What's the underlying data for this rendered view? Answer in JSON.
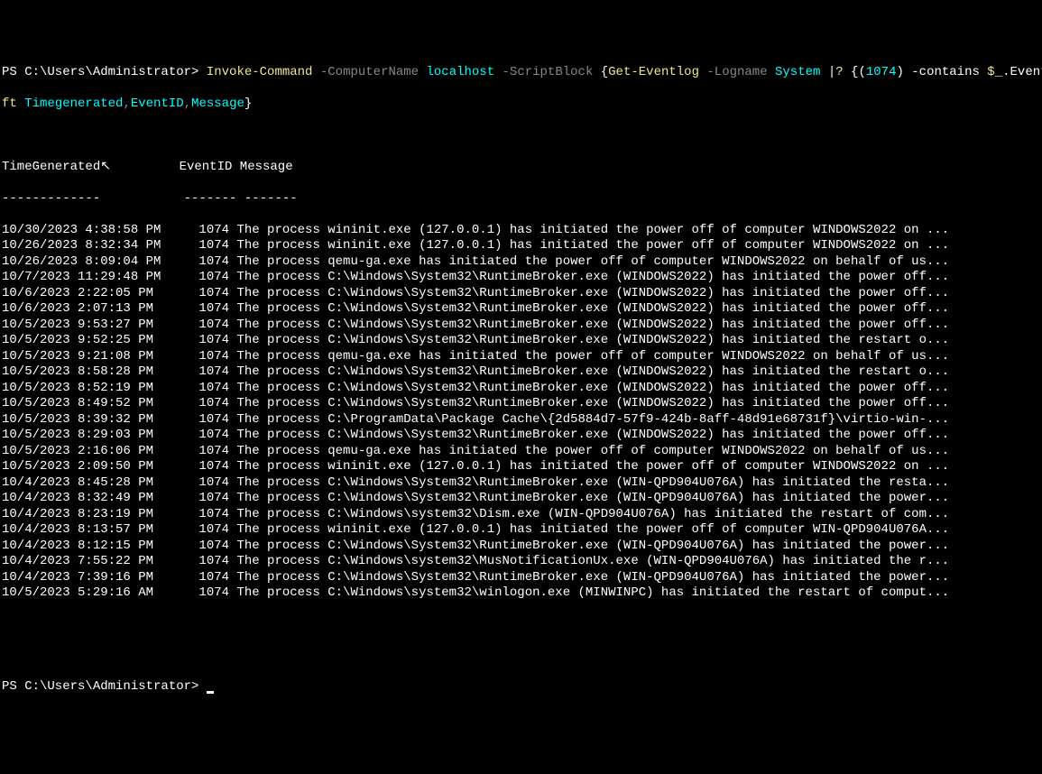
{
  "command": {
    "prompt_prefix": "PS C:\\Users\\Administrator> ",
    "cmd_yellow1": "Invoke-Command",
    "cmd_gray1": " -ComputerName ",
    "cmd_cyan1": "localhost",
    "cmd_gray2": " -ScriptBlock ",
    "cmd_white1": "{",
    "cmd_yellow2": "Get-Eventlog",
    "cmd_gray3": " -Logname ",
    "cmd_cyan2": "System",
    "cmd_white2": " |",
    "cmd_yellow3": "? ",
    "cmd_white3": "{(",
    "cmd_cyan3": "1074",
    "cmd_white4": ") -contains ",
    "cmd_yellow4": "$_",
    "cmd_white5": ".EventID} |",
    "line2_yellow": "ft",
    "line2_cyan": " Timegenerated",
    "line2_gray1": ",",
    "line2_cyan2": "EventID",
    "line2_gray2": ",",
    "line2_cyan3": "Message",
    "line2_white": "}"
  },
  "headers": {
    "col1": "TimeGenerated",
    "col2": "EventID",
    "col3": "Message",
    "sep1": "-------------",
    "sep2": "-------",
    "sep3": "-------"
  },
  "rows": [
    {
      "time": "10/30/2023 4:38:58 PM",
      "id": "1074",
      "msg": "The process wininit.exe (127.0.0.1) has initiated the power off of computer WINDOWS2022 on ..."
    },
    {
      "time": "10/26/2023 8:32:34 PM",
      "id": "1074",
      "msg": "The process wininit.exe (127.0.0.1) has initiated the power off of computer WINDOWS2022 on ..."
    },
    {
      "time": "10/26/2023 8:09:04 PM",
      "id": "1074",
      "msg": "The process qemu-ga.exe has initiated the power off of computer WINDOWS2022 on behalf of us..."
    },
    {
      "time": "10/7/2023 11:29:48 PM",
      "id": "1074",
      "msg": "The process C:\\Windows\\System32\\RuntimeBroker.exe (WINDOWS2022) has initiated the power off..."
    },
    {
      "time": "10/6/2023 2:22:05 PM",
      "id": "1074",
      "msg": "The process C:\\Windows\\System32\\RuntimeBroker.exe (WINDOWS2022) has initiated the power off..."
    },
    {
      "time": "10/6/2023 2:07:13 PM",
      "id": "1074",
      "msg": "The process C:\\Windows\\System32\\RuntimeBroker.exe (WINDOWS2022) has initiated the power off..."
    },
    {
      "time": "10/5/2023 9:53:27 PM",
      "id": "1074",
      "msg": "The process C:\\Windows\\System32\\RuntimeBroker.exe (WINDOWS2022) has initiated the power off..."
    },
    {
      "time": "10/5/2023 9:52:25 PM",
      "id": "1074",
      "msg": "The process C:\\Windows\\System32\\RuntimeBroker.exe (WINDOWS2022) has initiated the restart o..."
    },
    {
      "time": "10/5/2023 9:21:08 PM",
      "id": "1074",
      "msg": "The process qemu-ga.exe has initiated the power off of computer WINDOWS2022 on behalf of us..."
    },
    {
      "time": "10/5/2023 8:58:28 PM",
      "id": "1074",
      "msg": "The process C:\\Windows\\System32\\RuntimeBroker.exe (WINDOWS2022) has initiated the restart o..."
    },
    {
      "time": "10/5/2023 8:52:19 PM",
      "id": "1074",
      "msg": "The process C:\\Windows\\System32\\RuntimeBroker.exe (WINDOWS2022) has initiated the power off..."
    },
    {
      "time": "10/5/2023 8:49:52 PM",
      "id": "1074",
      "msg": "The process C:\\Windows\\System32\\RuntimeBroker.exe (WINDOWS2022) has initiated the power off..."
    },
    {
      "time": "10/5/2023 8:39:32 PM",
      "id": "1074",
      "msg": "The process C:\\ProgramData\\Package Cache\\{2d5884d7-57f9-424b-8aff-48d91e68731f}\\virtio-win-..."
    },
    {
      "time": "10/5/2023 8:29:03 PM",
      "id": "1074",
      "msg": "The process C:\\Windows\\System32\\RuntimeBroker.exe (WINDOWS2022) has initiated the power off..."
    },
    {
      "time": "10/5/2023 2:16:06 PM",
      "id": "1074",
      "msg": "The process qemu-ga.exe has initiated the power off of computer WINDOWS2022 on behalf of us..."
    },
    {
      "time": "10/5/2023 2:09:50 PM",
      "id": "1074",
      "msg": "The process wininit.exe (127.0.0.1) has initiated the power off of computer WINDOWS2022 on ..."
    },
    {
      "time": "10/4/2023 8:45:28 PM",
      "id": "1074",
      "msg": "The process C:\\Windows\\System32\\RuntimeBroker.exe (WIN-QPD904U076A) has initiated the resta..."
    },
    {
      "time": "10/4/2023 8:32:49 PM",
      "id": "1074",
      "msg": "The process C:\\Windows\\System32\\RuntimeBroker.exe (WIN-QPD904U076A) has initiated the power..."
    },
    {
      "time": "10/4/2023 8:23:19 PM",
      "id": "1074",
      "msg": "The process C:\\Windows\\system32\\Dism.exe (WIN-QPD904U076A) has initiated the restart of com..."
    },
    {
      "time": "10/4/2023 8:13:57 PM",
      "id": "1074",
      "msg": "The process wininit.exe (127.0.0.1) has initiated the power off of computer WIN-QPD904U076A..."
    },
    {
      "time": "10/4/2023 8:12:15 PM",
      "id": "1074",
      "msg": "The process C:\\Windows\\System32\\RuntimeBroker.exe (WIN-QPD904U076A) has initiated the power..."
    },
    {
      "time": "10/4/2023 7:55:22 PM",
      "id": "1074",
      "msg": "The process C:\\Windows\\system32\\MusNotificationUx.exe (WIN-QPD904U076A) has initiated the r..."
    },
    {
      "time": "10/4/2023 7:39:16 PM",
      "id": "1074",
      "msg": "The process C:\\Windows\\System32\\RuntimeBroker.exe (WIN-QPD904U076A) has initiated the power..."
    },
    {
      "time": "10/5/2023 5:29:16 AM",
      "id": "1074",
      "msg": "The process C:\\Windows\\system32\\winlogon.exe (MINWINPC) has initiated the restart of comput..."
    }
  ],
  "prompt2": "PS C:\\Users\\Administrator> "
}
